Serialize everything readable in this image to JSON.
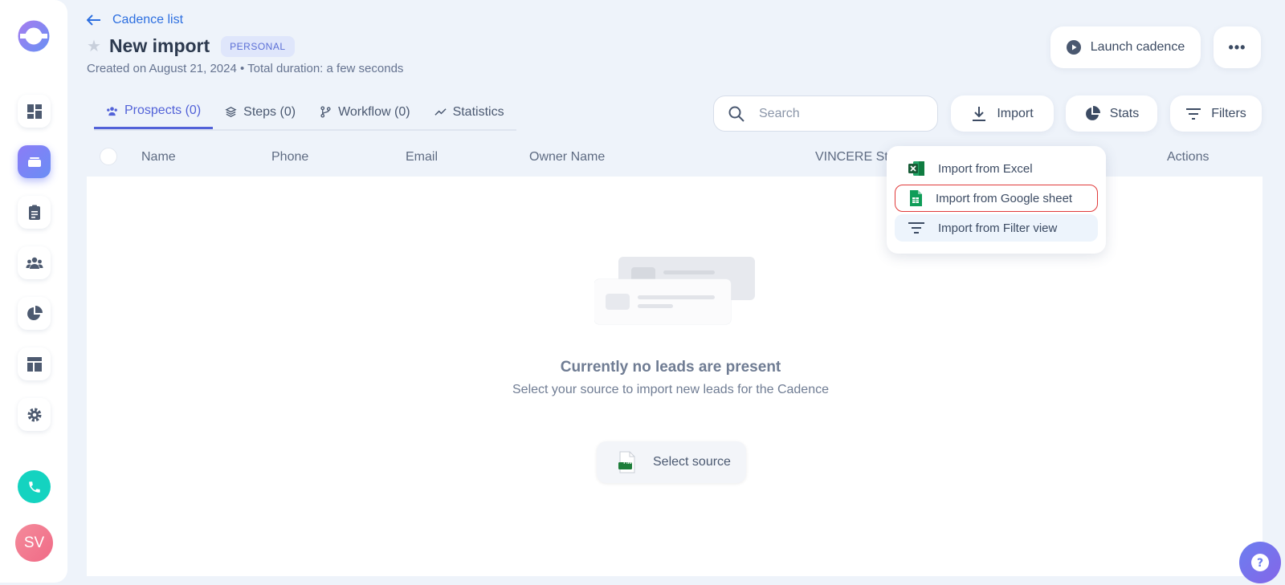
{
  "header": {
    "back_label": "Cadence list",
    "title": "New import",
    "badge": "PERSONAL",
    "subtitle": "Created on August 21, 2024 • Total duration: a few seconds",
    "launch_label": "Launch cadence"
  },
  "tabs": [
    {
      "label": "Prospects (0)",
      "icon": "people-icon"
    },
    {
      "label": "Steps (0)",
      "icon": "layers-icon"
    },
    {
      "label": "Workflow (0)",
      "icon": "branch-icon"
    },
    {
      "label": "Statistics",
      "icon": "trend-icon"
    }
  ],
  "toolbar": {
    "search_placeholder": "Search",
    "import_label": "Import",
    "stats_label": "Stats",
    "filters_label": "Filters"
  },
  "table": {
    "columns": [
      "Name",
      "Phone",
      "Email",
      "Owner Name",
      "VINCERE Stat",
      "Actions"
    ]
  },
  "dropdown": {
    "items": [
      "Import from Excel",
      "Import from Google sheet",
      "Import from Filter view"
    ]
  },
  "empty_state": {
    "title": "Currently no leads are present",
    "subtitle": "Select your source to import new leads for the Cadence",
    "button_label": "Select source",
    "file_tag": "File"
  },
  "user": {
    "initials": "SV"
  },
  "colors": {
    "accent": "#5262d8",
    "link": "#2d6fe0",
    "phone": "#14d3c0",
    "highlight_border": "#e03a3a"
  }
}
